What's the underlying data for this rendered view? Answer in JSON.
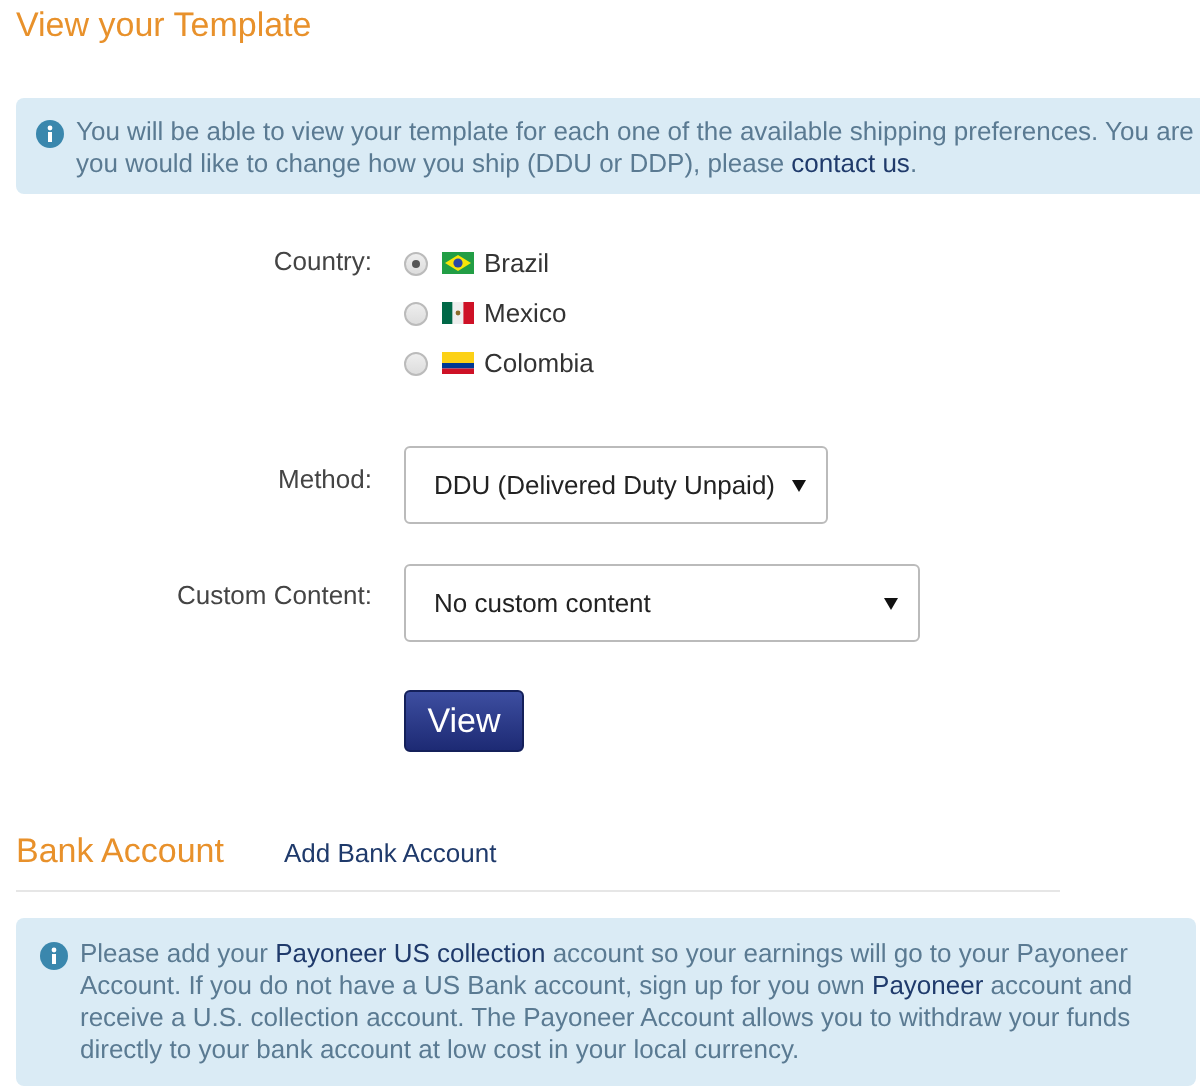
{
  "template_section": {
    "title": "View your Template",
    "notice_lines": [
      [
        {
          "kind": "text",
          "text": "You will be able to view your template for each one of the available shipping preferences. You are"
        }
      ],
      [
        {
          "kind": "text",
          "text": "you would like to change how you ship (DDU or DDP), please "
        },
        {
          "kind": "link",
          "text": "contact us"
        },
        {
          "kind": "text",
          "text": "."
        }
      ]
    ],
    "country": {
      "label": "Country:",
      "options": [
        {
          "name": "Brazil",
          "kind": "brazil",
          "selected": true
        },
        {
          "name": "Mexico",
          "kind": "mexico",
          "selected": false
        },
        {
          "name": "Colombia",
          "kind": "colombia",
          "selected": false
        }
      ]
    },
    "method": {
      "label": "Method:",
      "value": "DDU (Delivered Duty Unpaid)"
    },
    "custom_content": {
      "label": "Custom Content:",
      "value": "No custom content"
    },
    "view_button": "View"
  },
  "bank_section": {
    "title": "Bank Account",
    "add_link": "Add Bank Account",
    "notice": [
      {
        "kind": "text",
        "text": "Please add your "
      },
      {
        "kind": "link",
        "text": "Payoneer US collection"
      },
      {
        "kind": "text",
        "text": " account so your earnings will go to your Payoneer Account. If you do not have a US Bank account, sign up for you own "
      },
      {
        "kind": "link",
        "text": "Payoneer"
      },
      {
        "kind": "text",
        "text": " account and receive a U.S. collection account. The Payoneer Account allows you to withdraw your funds directly to your bank account at low cost in your local currency."
      }
    ]
  }
}
